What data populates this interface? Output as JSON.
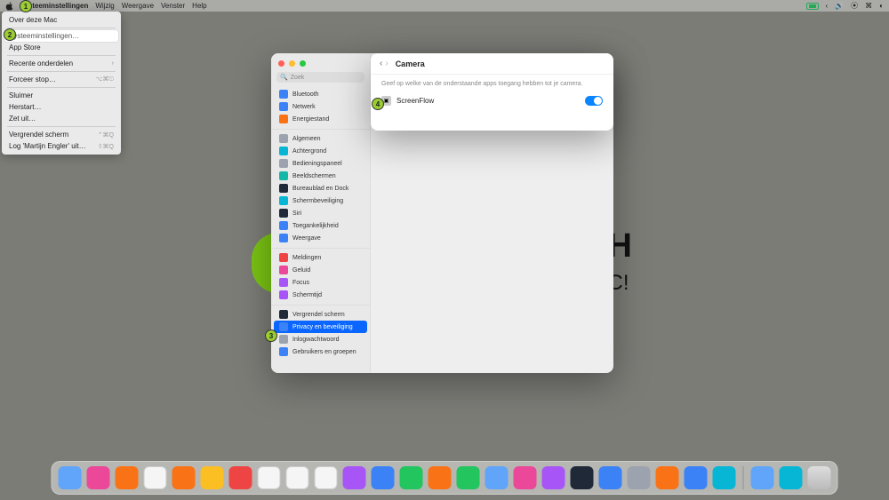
{
  "menubar": {
    "app": "Systeeminstellingen",
    "items": [
      "Wijzig",
      "Weergave",
      "Venster",
      "Help"
    ]
  },
  "apple_menu": {
    "about": "Over deze Mac",
    "settings": "Systeeminstellingen…",
    "appstore": "App Store",
    "recent": "Recente onderdelen",
    "force": "Forceer stop…",
    "force_sc": "⌥⌘⎋",
    "sleep": "Sluimer",
    "restart": "Herstart…",
    "shutdown": "Zet uit…",
    "lock": "Vergrendel scherm",
    "lock_sc": "⌃⌘Q",
    "logout": "Log 'Martijn Engler' uit…",
    "logout_sc": "⇧⌘Q"
  },
  "search_placeholder": "Zoek",
  "sidebar": {
    "g1": [
      {
        "label": "Bluetooth",
        "color": "c-blue"
      },
      {
        "label": "Netwerk",
        "color": "c-blue"
      },
      {
        "label": "Energiestand",
        "color": "c-orange"
      }
    ],
    "g2": [
      {
        "label": "Algemeen",
        "color": "c-gray"
      },
      {
        "label": "Achtergrond",
        "color": "c-cyan"
      },
      {
        "label": "Bedieningspaneel",
        "color": "c-gray"
      },
      {
        "label": "Beeldschermen",
        "color": "c-teal"
      },
      {
        "label": "Bureaublad en Dock",
        "color": "c-dark"
      },
      {
        "label": "Schermbeveiliging",
        "color": "c-cyan"
      },
      {
        "label": "Siri",
        "color": "c-dark"
      },
      {
        "label": "Toegankelijkheid",
        "color": "c-blue"
      },
      {
        "label": "Weergave",
        "color": "c-blue"
      }
    ],
    "g3": [
      {
        "label": "Meldingen",
        "color": "c-red"
      },
      {
        "label": "Geluid",
        "color": "c-pink"
      },
      {
        "label": "Focus",
        "color": "c-purple"
      },
      {
        "label": "Schermtijd",
        "color": "c-purple"
      }
    ],
    "g4": [
      {
        "label": "Vergrendel scherm",
        "color": "c-dark"
      },
      {
        "label": "Privacy en beveiliging",
        "color": "c-blue",
        "selected": true
      },
      {
        "label": "Inlogwachtwoord",
        "color": "c-gray"
      },
      {
        "label": "Gebruikers en groepen",
        "color": "c-blue"
      }
    ]
  },
  "detail": {
    "title": "Camera",
    "desc": "Geef op welke van de onderstaande apps toegang hebben tot je camera.",
    "app": "ScreenFlow"
  },
  "bg": {
    "l1": "H",
    "l2": "C!"
  },
  "badges": {
    "1": "1",
    "2": "2",
    "3": "3",
    "4": "4"
  },
  "dock_colors": [
    "c-lblue",
    "c-pink",
    "c-orange",
    "c-white",
    "c-orange",
    "c-yellow",
    "c-red",
    "c-white",
    "c-white",
    "c-white",
    "c-purple",
    "c-blue",
    "c-green",
    "c-orange",
    "c-green",
    "c-lblue",
    "c-pink",
    "c-purple",
    "c-dark",
    "c-blue",
    "c-gray",
    "c-orange",
    "c-blue",
    "c-cyan"
  ]
}
